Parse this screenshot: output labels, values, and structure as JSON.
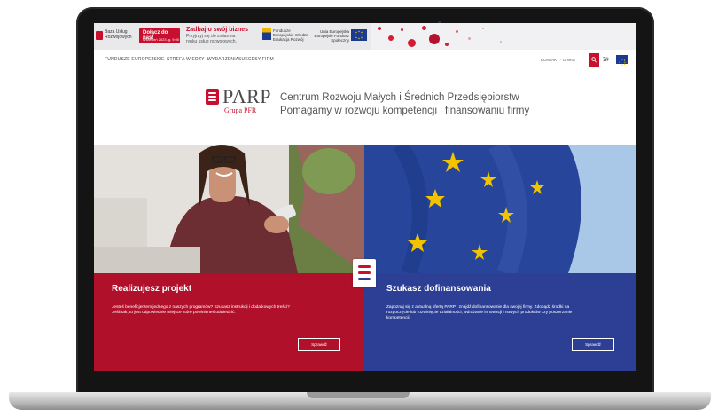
{
  "banner": {
    "service_logo_text": "Baza Usług Rozwojowych",
    "join_label": "Dołącz do nas!",
    "join_sub": "Wrzesień 2023, g. 9:00",
    "promo_heading": "Zadbaj o swój biznes",
    "promo_sub": "Przyjrzyj się do zmian na rynku usług rozwojowych.",
    "funds_logo_text": "Fundusze Europejskie Wiedza Edukacja Rozwój",
    "eu_logo_text": "Unia Europejska Europejski Fundusz Społeczny"
  },
  "nav": {
    "items": [
      "FUNDUSZE EUROPEJSKIE ⌄",
      "STREFA WIEDZY ⌄",
      "WYDARZENIA",
      "SUKCESY FIRM"
    ],
    "contact": "KONTAKT · O NAS",
    "a11y": "ﾌ/ᶨ"
  },
  "brand": {
    "name": "PARP",
    "group": "Grupa PFR",
    "tagline_1": "Centrum Rozwoju Małych i Średnich Przedsiębiorstw",
    "tagline_2": "Pomagamy w rozwoju kompetencji i finansowaniu firmy"
  },
  "cards": {
    "left": {
      "title": "Realizujesz projekt",
      "desc": "Jesteś beneficjentem jednego z naszych programów? Szukasz instrukcji i dodatkowych treści? Jeśli tak, to jest odpowiednie miejsce które powinieneś odwiedzić.",
      "button": "Sprawdź"
    },
    "right": {
      "title": "Szukasz dofinansowania",
      "desc": "Zapoznaj się z aktualną ofertą PARP i znajdź dofinansowanie dla swojej firmy. Zdobądź środki na rozpoczęcie lub rozwinięcie działalności, wdrażanie innowacji i nowych produktów czy poszerzanie kompetencji.",
      "button": "Sprawdź"
    }
  },
  "colors": {
    "brand_red": "#c8102e",
    "eu_blue": "#2c3f94",
    "card_red": "#b0102a"
  }
}
